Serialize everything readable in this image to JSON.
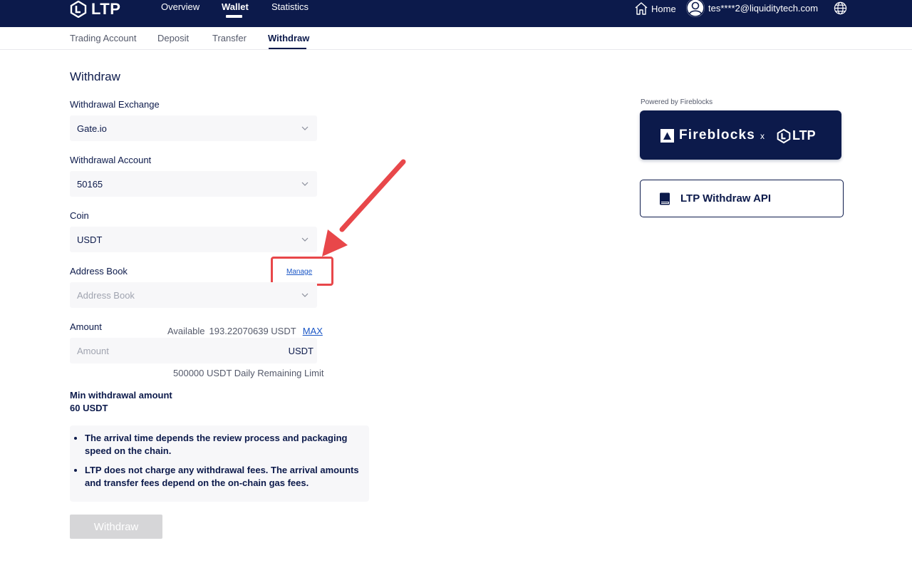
{
  "header": {
    "logo_text": "LTP",
    "nav": [
      {
        "label": "Overview",
        "active": false
      },
      {
        "label": "Wallet",
        "active": true
      },
      {
        "label": "Statistics",
        "active": false
      }
    ],
    "home_label": "Home",
    "user_email": "tes****2@liquiditytech.com"
  },
  "subnav": {
    "items": [
      {
        "label": "Trading Account"
      },
      {
        "label": "Deposit"
      },
      {
        "label": "Transfer"
      },
      {
        "label": "Withdraw",
        "active": true
      }
    ]
  },
  "form": {
    "title": "Withdraw",
    "exchange": {
      "label": "Withdrawal Exchange",
      "value": "Gate.io"
    },
    "account": {
      "label": "Withdrawal Account",
      "value": "50165"
    },
    "coin": {
      "label": "Coin",
      "value": "USDT"
    },
    "address_book": {
      "label": "Address Book",
      "placeholder": "Address Book",
      "manage_label": "Manage"
    },
    "amount": {
      "label": "Amount",
      "available_label": "Available",
      "available_value": "193.22070639 USDT",
      "max_label": "MAX",
      "placeholder": "Amount",
      "unit": "USDT",
      "daily_limit": "500000 USDT Daily Remaining Limit"
    },
    "min_withdrawal": {
      "label": "Min withdrawal amount",
      "value": "60 USDT"
    },
    "notes": [
      "The arrival time depends the review process and packaging speed on the chain.",
      "LTP does not charge any withdrawal fees. The arrival amounts and transfer fees depend on the on-chain gas fees."
    ],
    "submit_label": "Withdraw"
  },
  "sidebar": {
    "powered_by": "Powered by Fireblocks",
    "banner": {
      "brand": "Fireblocks",
      "separator": "x",
      "partner": "LTP"
    },
    "api_card": {
      "label": "LTP Withdraw API",
      "icon": "book-icon"
    }
  },
  "colors": {
    "navy": "#0c1a4b",
    "link": "#1a56c6",
    "highlight": "#e8474a",
    "field_bg": "#f7f7f9",
    "disabled_button": "#d6d6d8"
  }
}
